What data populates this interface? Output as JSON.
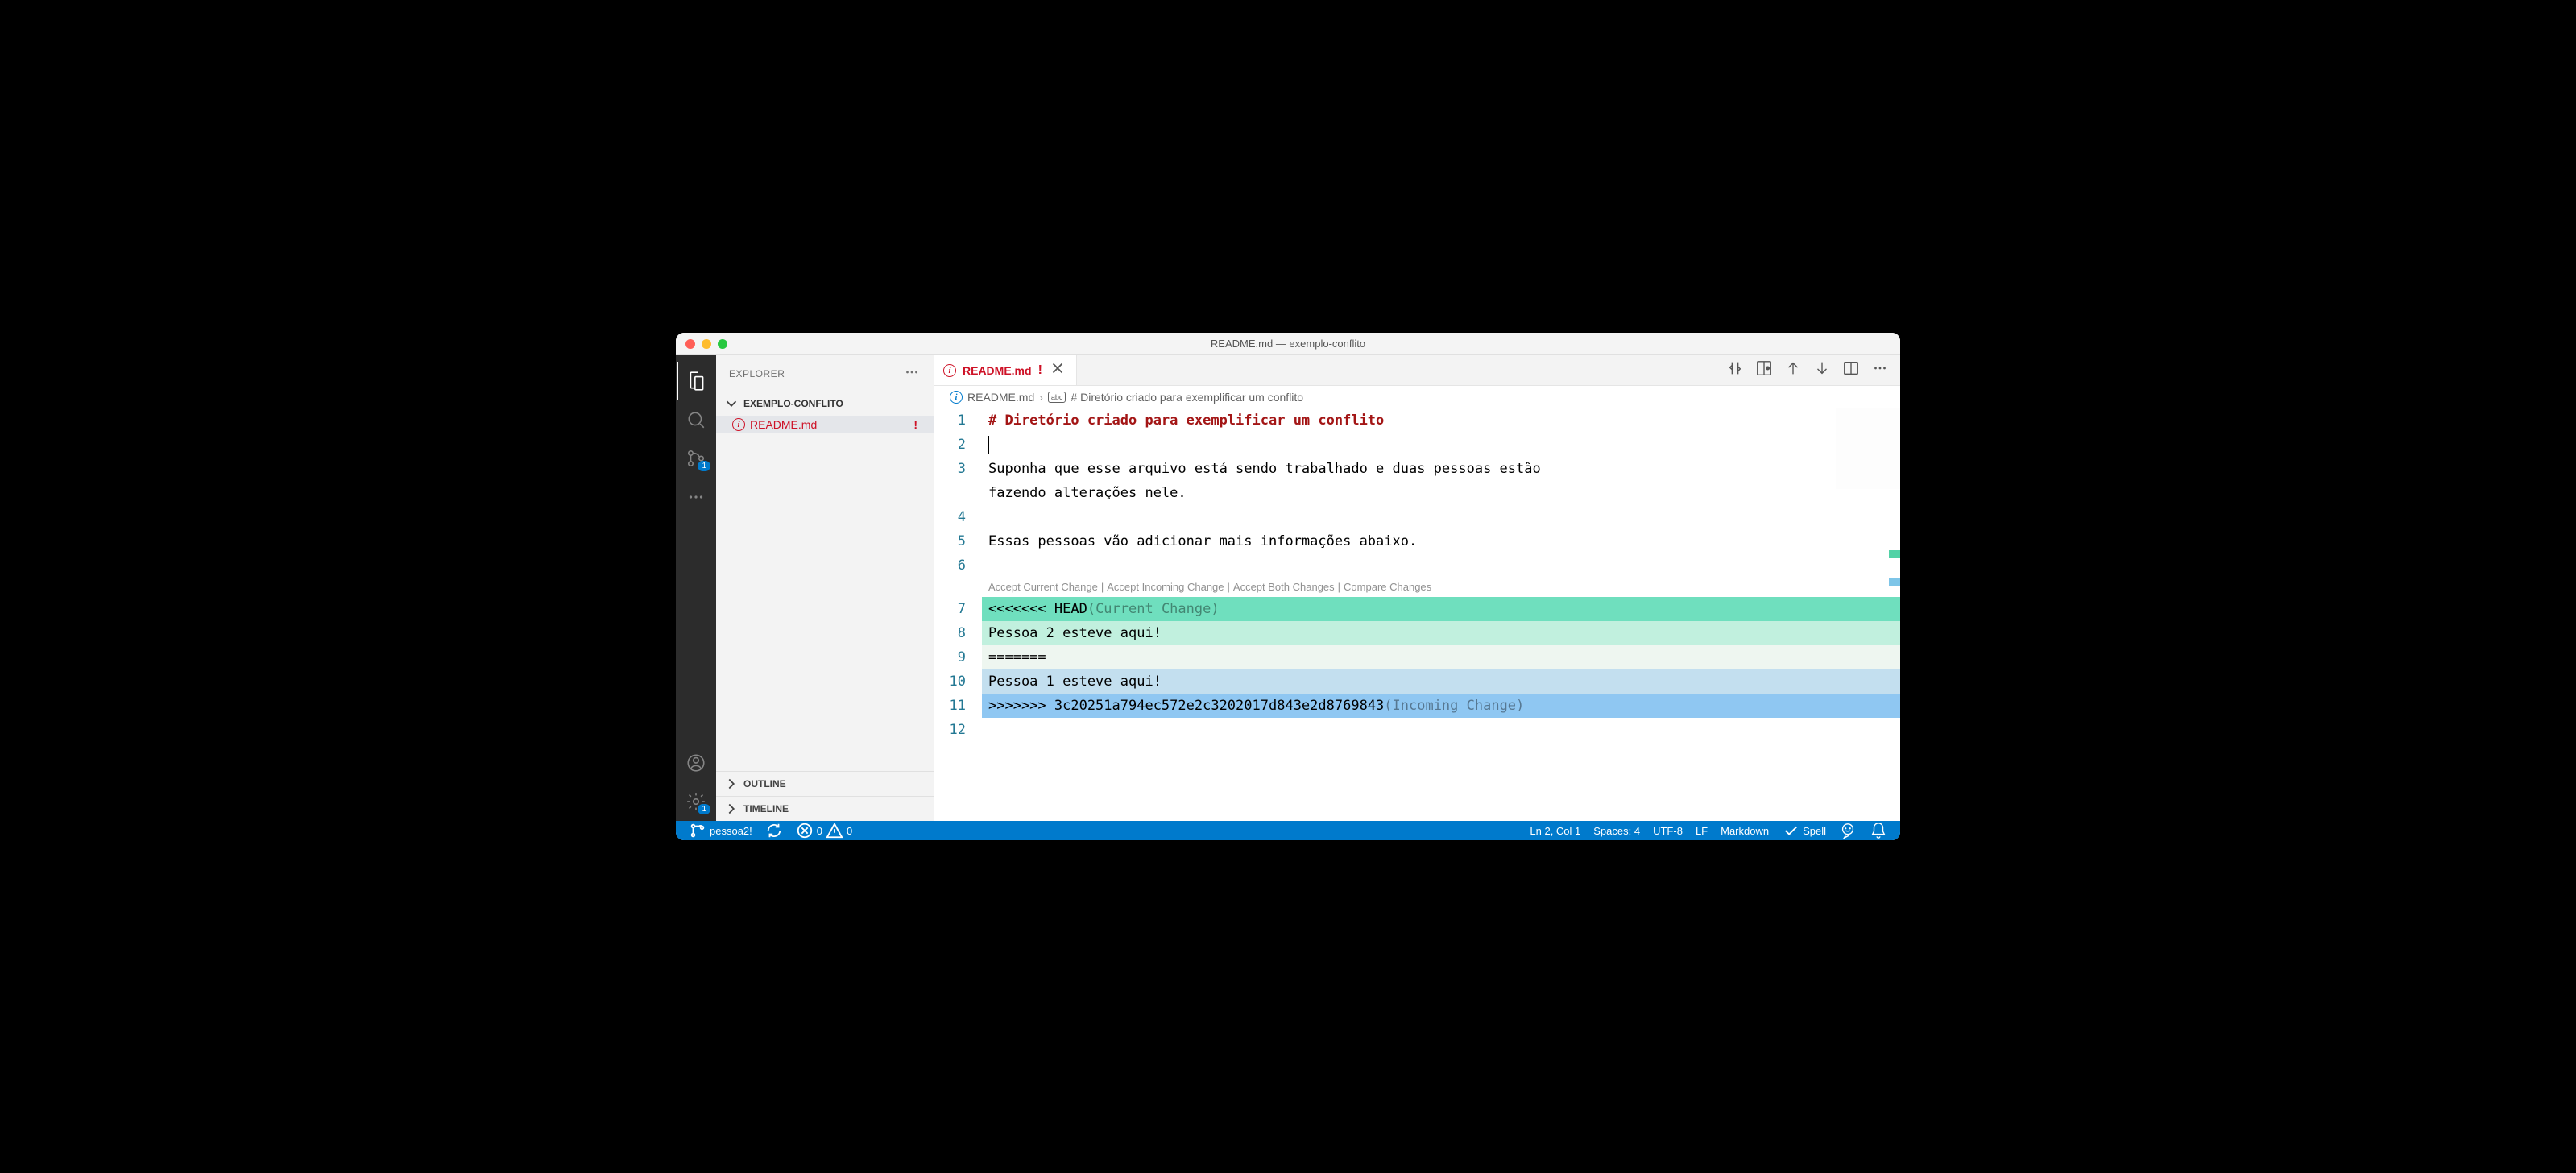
{
  "window": {
    "title": "README.md — exemplo-conflito"
  },
  "sidebar": {
    "title": "EXPLORER",
    "folder": "EXEMPLO-CONFLITO",
    "file": "README.md",
    "outline": "OUTLINE",
    "timeline": "TIMELINE"
  },
  "activity": {
    "scm_badge": "1",
    "settings_badge": "1"
  },
  "tab": {
    "name": "README.md",
    "marker": "!"
  },
  "breadcrumb": {
    "file": "README.md",
    "symbol": "# Diretório criado para exemplificar um conflito"
  },
  "editor": {
    "lines": [
      "1",
      "2",
      "3",
      "4",
      "5",
      "6",
      "7",
      "8",
      "9",
      "10",
      "11",
      "12"
    ],
    "line1": "# Diretório criado para exemplificar um conflito",
    "line3a": "Suponha que esse arquivo está sendo trabalhado e duas pessoas estão",
    "line3b": "fazendo alterações nele.",
    "line5": "Essas pessoas vão adicionar mais informações abaixo.",
    "codelens": {
      "accept_current": "Accept Current Change",
      "accept_incoming": "Accept Incoming Change",
      "accept_both": "Accept Both Changes",
      "compare": "Compare Changes"
    },
    "line7_marker": "<<<<<<< HEAD",
    "line7_annot": "(Current Change)",
    "line8": "Pessoa 2 esteve aqui!",
    "line9": "=======",
    "line10": "Pessoa 1 esteve aqui!",
    "line11_marker": ">>>>>>> 3c20251a794ec572e2c3202017d843e2d8769843",
    "line11_annot": "(Incoming Change)"
  },
  "status": {
    "branch": "pessoa2!",
    "errors": "0",
    "warnings": "0",
    "cursor": "Ln 2, Col 1",
    "spaces": "Spaces: 4",
    "encoding": "UTF-8",
    "eol": "LF",
    "lang": "Markdown",
    "spell": "Spell"
  }
}
